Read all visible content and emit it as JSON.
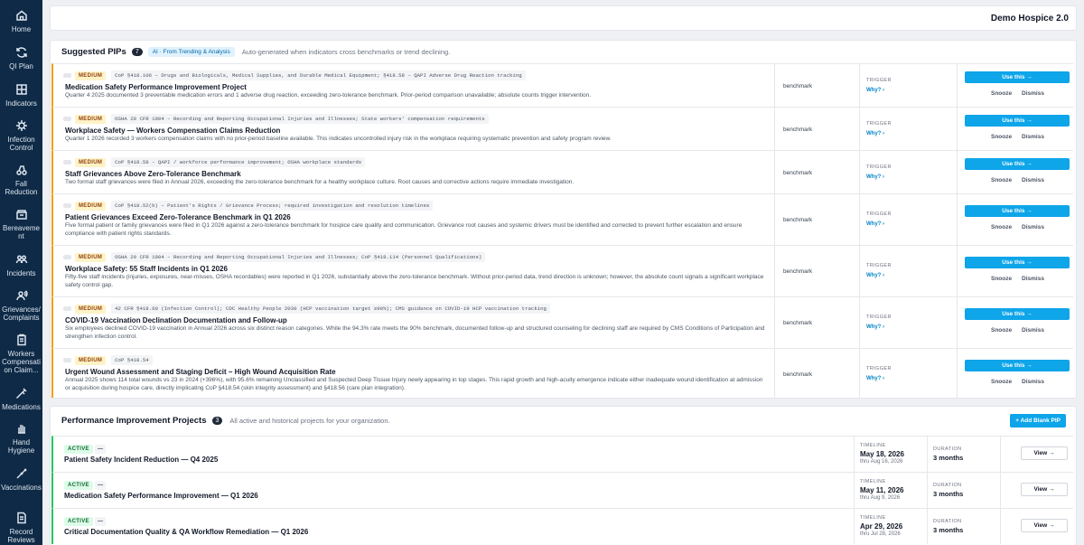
{
  "sidebar": {
    "items": [
      {
        "label": "Home",
        "icon": "home-icon"
      },
      {
        "label": "QI Plan",
        "icon": "refresh-icon"
      },
      {
        "label": "Indicators",
        "icon": "chart-icon"
      },
      {
        "label": "Infection Control",
        "icon": "virus-icon"
      },
      {
        "label": "Fall Reduction",
        "icon": "walker-icon"
      },
      {
        "label": "Bereavement",
        "icon": "box-icon"
      },
      {
        "label": "Incidents",
        "icon": "people-icon"
      },
      {
        "label": "Grievances/ Complaints",
        "icon": "user-voice-icon"
      },
      {
        "label": "Workers Compensation Claim...",
        "icon": "clipboard-icon"
      },
      {
        "label": "Medications",
        "icon": "syringe-icon"
      },
      {
        "label": "Hand Hygiene",
        "icon": "hand-icon"
      },
      {
        "label": "Vaccinations",
        "icon": "needle-icon"
      },
      {
        "label": "Record Reviews",
        "icon": "document-icon"
      }
    ]
  },
  "header": {
    "org_name": "Demo Hospice 2.0"
  },
  "suggested": {
    "title": "Suggested PIPs",
    "count": "7",
    "ai_badge": "AI · From Trending & Analysis",
    "subtitle": "Auto-generated when indicators cross benchmarks or trend declining.",
    "trigger_label": "TRIGGER",
    "why_label": "Why? ›",
    "use_label": "Use this →",
    "snooze_label": "Snooze",
    "dismiss_label": "Dismiss",
    "items": [
      {
        "severity": "MEDIUM",
        "citation": "CoP §418.106 – Drugs and Biologicals, Medical Supplies, and Durable Medical Equipment; §418.58 – QAPI Adverse Drug Reaction tracking",
        "title": "Medication Safety Performance Improvement Project",
        "description": "Quarter 4 2025 documented 3 preventable medication errors and 1 adverse drug reaction, exceeding zero-tolerance benchmark. Prior-period comparison unavailable; absolute counts trigger intervention.",
        "source": "benchmark"
      },
      {
        "severity": "MEDIUM",
        "citation": "OSHA 29 CFR 1904 – Recording and Reporting Occupational Injuries and Illnesses; State workers' compensation requirements",
        "title": "Workplace Safety — Workers Compensation Claims Reduction",
        "description": "Quarter 1 2026 recorded 3 workers compensation claims with no prior-period baseline available. This indicates uncontrolled injury risk in the workplace requiring systematic prevention and safety program review.",
        "source": "benchmark"
      },
      {
        "severity": "MEDIUM",
        "citation": "CoP §418.58 – QAPI / workforce performance improvement; OSHA workplace standards",
        "title": "Staff Grievances Above Zero-Tolerance Benchmark",
        "description": "Two formal staff grievances were filed in Annual 2026, exceeding the zero-tolerance benchmark for a healthy workplace culture. Root causes and corrective actions require immediate investigation.",
        "source": "benchmark"
      },
      {
        "severity": "MEDIUM",
        "citation": "CoP §418.52(b) – Patient's Rights / Grievance Process; required investigation and resolution timelines",
        "title": "Patient Grievances Exceed Zero-Tolerance Benchmark in Q1 2026",
        "description": "Five formal patient or family grievances were filed in Q1 2026 against a zero-tolerance benchmark for hospice care quality and communication. Grievance root causes and systemic drivers must be identified and corrected to prevent further escalation and ensure compliance with patient rights standards.",
        "source": "benchmark"
      },
      {
        "severity": "MEDIUM",
        "citation": "OSHA 29 CFR 1904 – Recording and Reporting Occupational Injuries and Illnesses; CoP §418.114 (Personnel Qualifications)",
        "title": "Workplace Safety: 55 Staff Incidents in Q1 2026",
        "description": "Fifty-five staff incidents (injuries, exposures, near-misses, OSHA recordables) were reported in Q1 2026, substantially above the zero-tolerance benchmark. Without prior-period data, trend direction is unknown; however, the absolute count signals a significant workplace safety control gap.",
        "source": "benchmark"
      },
      {
        "severity": "MEDIUM",
        "citation": "42 CFR §418.60 (Infection Control); CDC Healthy People 2030 (HCP vaccination target ≥90%); CMS guidance on COVID-19 HCP vaccination tracking",
        "title": "COVID-19 Vaccination Declination Documentation and Follow-up",
        "description": "Six employees declined COVID-19 vaccination in Annual 2026 across six distinct reason categories. While the 94.3% rate meets the 90% benchmark, documented follow-up and structured counseling for declining staff are required by CMS Conditions of Participation and strengthen infection control.",
        "source": "benchmark"
      },
      {
        "severity": "MEDIUM",
        "citation": "CoP §418.54",
        "title": "Urgent Wound Assessment and Staging Deficit – High Wound Acquisition Rate",
        "description": "Annual 2025 shows 114 total wounds vs 23 in 2024 (+396%), with 95.6% remaining Unclassified and Suspected Deep Tissue Injury newly appearing in top stages. This rapid growth and high-acuity emergence indicate either inadequate wound identification at admission or acquisition during hospice care, directly implicating CoP §418.54 (skin integrity assessment) and §418.56 (care plan integration).",
        "source": "benchmark"
      }
    ]
  },
  "projects": {
    "title": "Performance Improvement Projects",
    "count": "3",
    "subtitle": "All active and historical projects for your organization.",
    "add_label": "+ Add Blank PIP",
    "timeline_label": "TIMELINE",
    "duration_label": "DURATION",
    "view_label": "View →",
    "items": [
      {
        "status": "ACTIVE",
        "tag": "—",
        "title": "Patient Safety Incident Reduction — Q4 2025",
        "start": "May 18, 2026",
        "end": "thru Aug 16, 2026",
        "duration": "3 months"
      },
      {
        "status": "ACTIVE",
        "tag": "—",
        "title": "Medication Safety Performance Improvement — Q1 2026",
        "start": "May 11, 2026",
        "end": "thru Aug 9, 2026",
        "duration": "3 months"
      },
      {
        "status": "ACTIVE",
        "tag": "—",
        "title": "Critical Documentation Quality & QA Workflow Remediation — Q1 2026",
        "start": "Apr 29, 2026",
        "end": "thru Jul 28, 2026",
        "duration": "3 months"
      }
    ]
  }
}
